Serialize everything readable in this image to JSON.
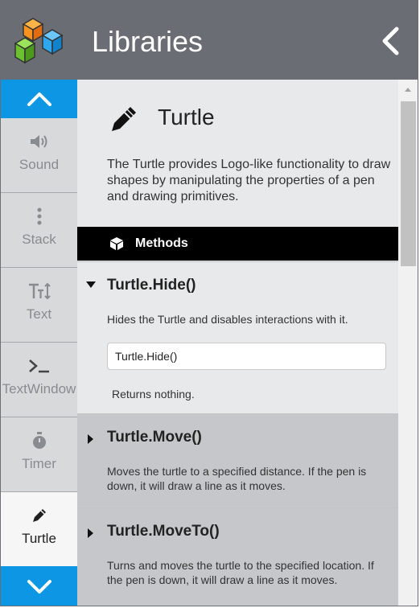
{
  "header": {
    "title": "Libraries",
    "back_icon": "chevron-left-icon"
  },
  "sidebar": {
    "up_icon": "chevron-up-icon",
    "down_icon": "chevron-down-icon",
    "items": [
      {
        "label": "Sound",
        "icon": "speaker-icon"
      },
      {
        "label": "Stack",
        "icon": "vertical-dots-icon"
      },
      {
        "label": "Text",
        "icon": "text-size-icon"
      },
      {
        "label": "TextWindow",
        "icon": "terminal-icon"
      },
      {
        "label": "Timer",
        "icon": "stopwatch-icon"
      },
      {
        "label": "Turtle",
        "icon": "pen-icon",
        "active": true
      }
    ]
  },
  "object": {
    "name": "Turtle",
    "icon": "pen-icon",
    "description": "The Turtle provides Logo-like functionality to draw shapes by manipulating the properties of a pen and drawing primitives."
  },
  "methods_section": {
    "label": "Methods",
    "icon": "cube-icon"
  },
  "methods": [
    {
      "name": "Turtle.Hide()",
      "expanded": true,
      "description": "Hides the Turtle and disables interactions with it.",
      "example": "Turtle.Hide()",
      "returns": "Returns nothing."
    },
    {
      "name": "Turtle.Move()",
      "expanded": false,
      "description": "Moves the turtle to a specified distance. If the pen is down, it will draw a line as it moves."
    },
    {
      "name": "Turtle.MoveTo()",
      "expanded": false,
      "description": "Turns and moves the turtle to the specified location. If the pen is down, it will draw a line as it moves."
    }
  ],
  "colors": {
    "header": "#6a6e74",
    "accent": "#0d96e4",
    "sidebar": "#d7d9db",
    "main": "#e8e9ea",
    "collapsed": "#c5c7ca"
  }
}
